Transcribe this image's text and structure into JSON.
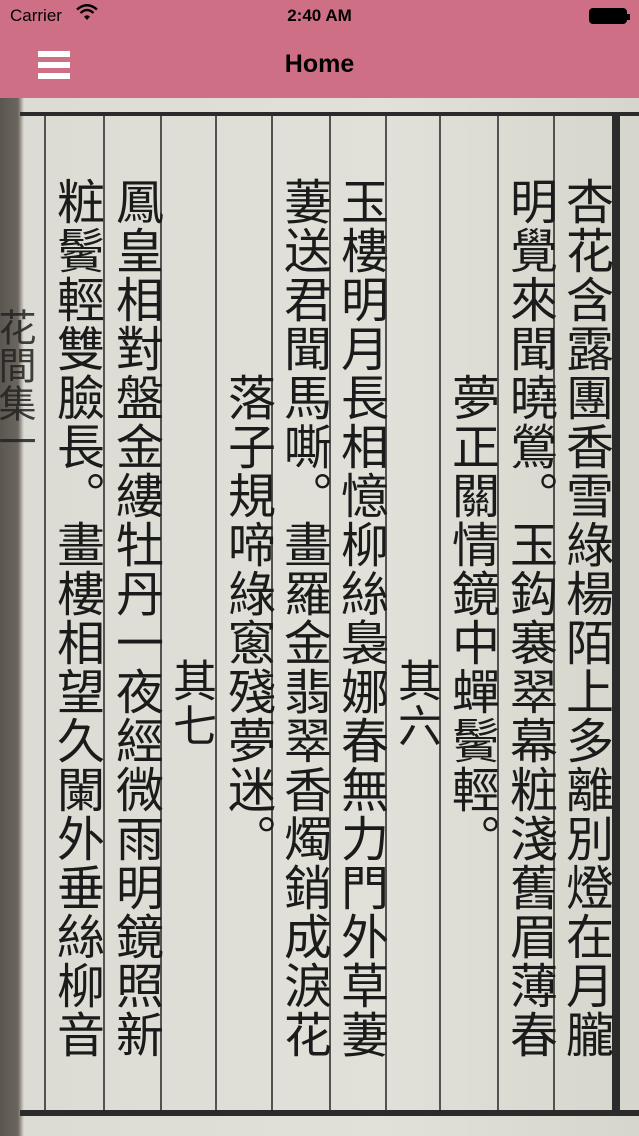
{
  "status_bar": {
    "carrier": "Carrier",
    "time": "2:40 AM"
  },
  "nav_bar": {
    "title": "Home",
    "menu_icon": "hamburger-menu-icon"
  },
  "colors": {
    "nav_background": "#cf6f85"
  },
  "page": {
    "spine_text": "花間集一",
    "columns": [
      "杏花含露團香雪綠楊陌上多離別燈在月朧",
      "明覺來聞曉鶯。玉鈎褰翠幕粧淺舊眉薄春",
      "夢正關情鏡中蟬鬢輕。",
      "其六",
      "玉樓明月長相憶柳絲裊娜春無力門外草萋",
      "萋送君聞馬嘶。畫羅金翡翠香燭銷成淚花",
      "落子規啼綠窻殘夢迷。",
      "其七",
      "鳳皇相對盤金縷牡丹一夜經微雨明鏡照新",
      "粧鬢輕雙臉長。畫樓相望久闌外垂絲柳音"
    ]
  }
}
